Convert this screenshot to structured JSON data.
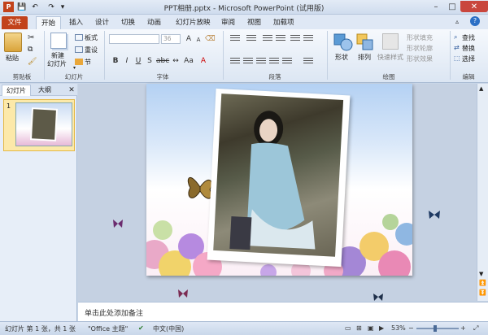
{
  "window": {
    "title": "PPT相册.pptx - Microsoft PowerPoint (试用版)"
  },
  "tabs": [
    "文件",
    "开始",
    "插入",
    "设计",
    "切换",
    "动画",
    "幻灯片放映",
    "审阅",
    "视图",
    "加载项"
  ],
  "ribbon": {
    "clipboard": {
      "paste": "粘贴",
      "group": "剪贴板"
    },
    "slides": {
      "new_slide": "新建",
      "new_slide2": "幻灯片",
      "layout": "板式",
      "reset": "重设",
      "section": "节",
      "group": "幻灯片"
    },
    "font": {
      "size": "36",
      "group": "字体"
    },
    "paragraph": {
      "group": "段落"
    },
    "drawing": {
      "shapes": "形状",
      "arrange": "排列",
      "quick_styles": "快速样式",
      "fill": "形状填充",
      "outline": "形状轮廓",
      "effects": "形状效果",
      "group": "绘图"
    },
    "editing": {
      "find": "查找",
      "replace": "替换",
      "select": "选择",
      "group": "编辑"
    }
  },
  "left_panel": {
    "tab_slides": "幻灯片",
    "tab_outline": "大纲",
    "slide_number": "1"
  },
  "notes": {
    "placeholder": "单击此处添加备注"
  },
  "status": {
    "slide_info": "幻灯片 第 1 张，共 1 张",
    "theme": "\"Office 主题\"",
    "language": "中文(中国)",
    "zoom": "53%"
  },
  "colors": {
    "file_tab": "#c2421b",
    "accent": "#2b579a"
  }
}
